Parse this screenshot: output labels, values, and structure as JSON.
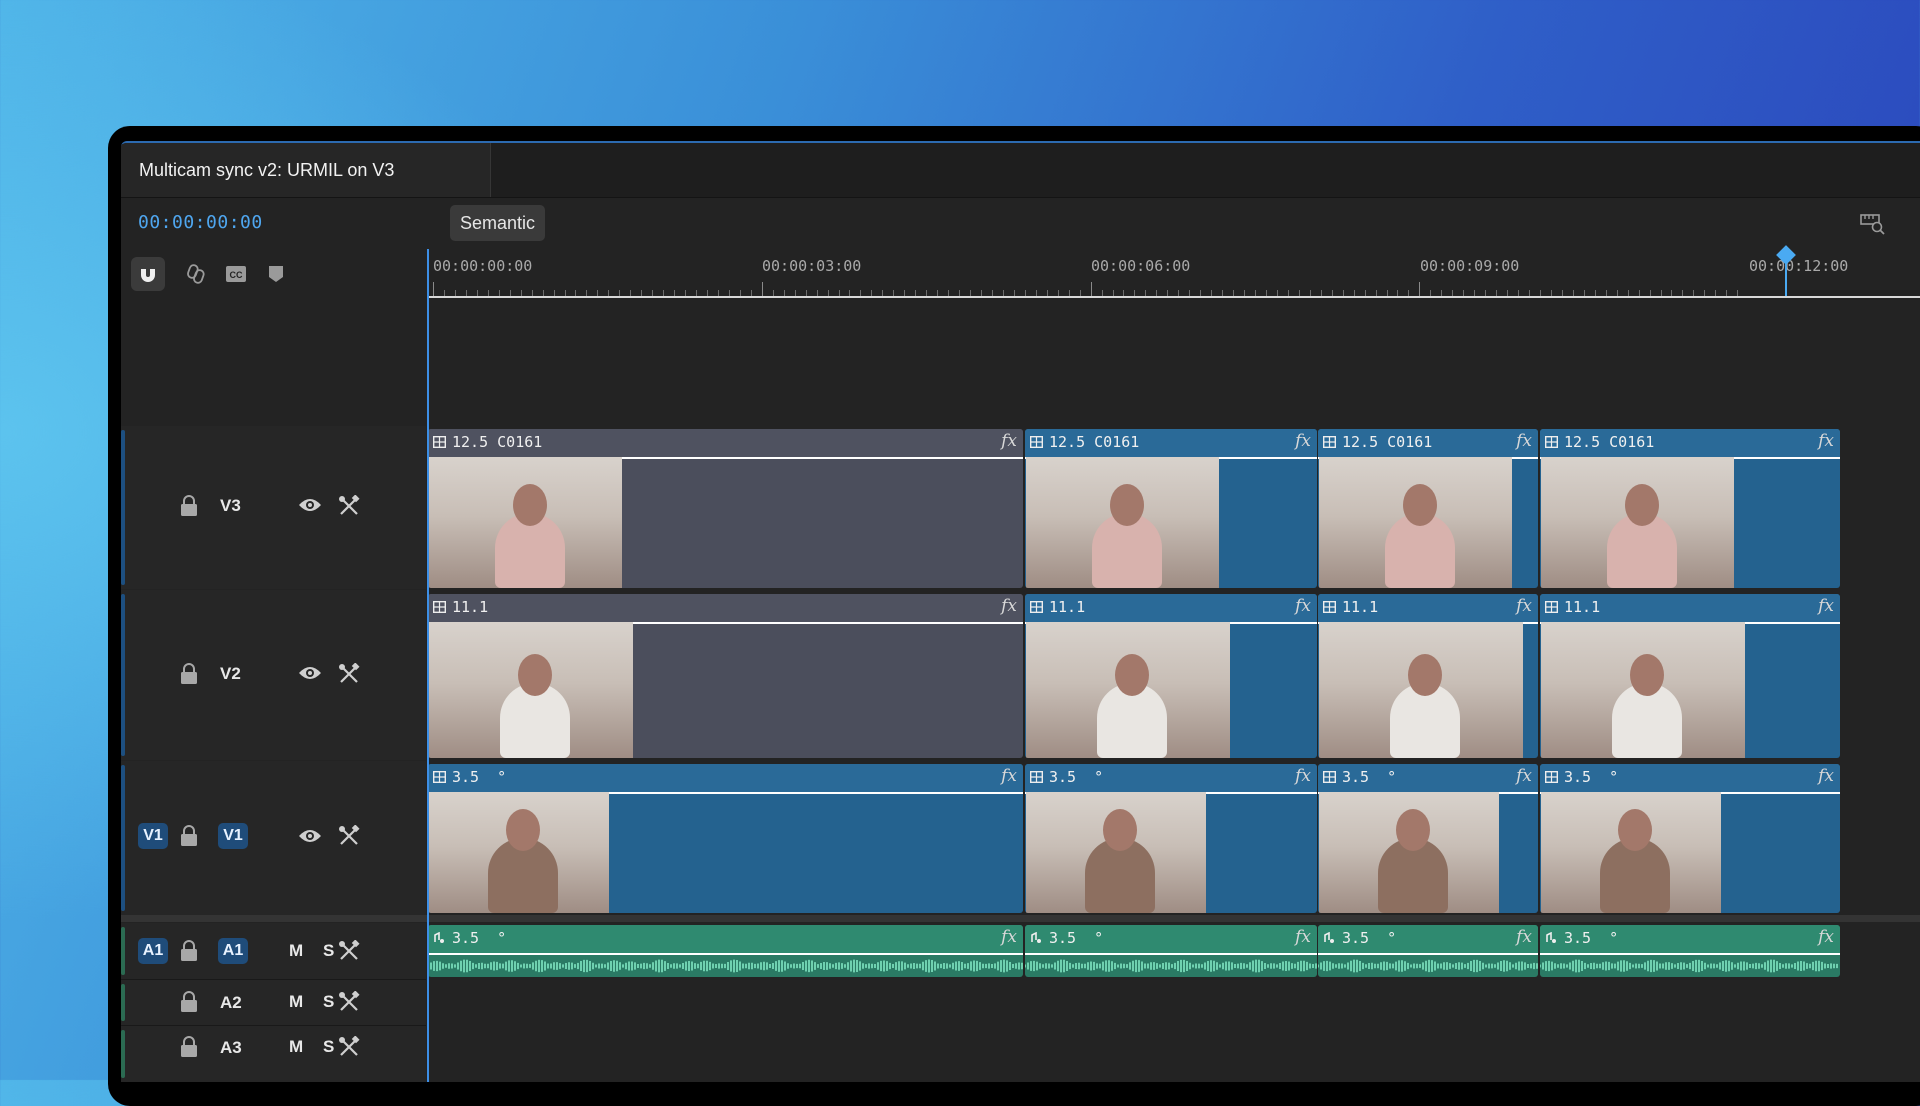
{
  "window": {
    "tab_title": "Multicam sync v2: URMIL on V3"
  },
  "toolbar": {
    "timecode": "00:00:00:00",
    "semantic_label": "Semantic",
    "tools": [
      "magnet-icon",
      "link-icon",
      "captions-icon",
      "marker-icon"
    ]
  },
  "ruler": {
    "labels": [
      "00:00:00:00",
      "00:00:03:00",
      "00:00:06:00",
      "00:00:09:00",
      "00:00:12:00"
    ]
  },
  "colors": {
    "accent": "#4fa6ef",
    "video_clip": "#24628f",
    "grey_clip": "#4b4e5c",
    "audio_clip": "#2a7a64"
  },
  "tracks": {
    "v3": {
      "label": "V3"
    },
    "v2": {
      "label": "V2"
    },
    "v1": {
      "source": "V1",
      "label": "V1"
    },
    "a1": {
      "source": "A1",
      "label": "A1",
      "mute": "M",
      "solo": "S"
    },
    "a2": {
      "label": "A2",
      "mute": "M",
      "solo": "S"
    },
    "a3": {
      "label": "A3",
      "mute": "M",
      "solo": "S"
    }
  },
  "clips": {
    "v3": [
      "12.5 C0161",
      "12.5 C0161",
      "12.5 C0161",
      "12.5 C0161"
    ],
    "v2": [
      "11.1",
      "11.1",
      "11.1",
      "11.1"
    ],
    "v1": [
      "3.5",
      "3.5",
      "3.5",
      "3.5"
    ],
    "a1": [
      "3.5",
      "3.5",
      "3.5",
      "3.5"
    ],
    "fx_label": "fx"
  }
}
